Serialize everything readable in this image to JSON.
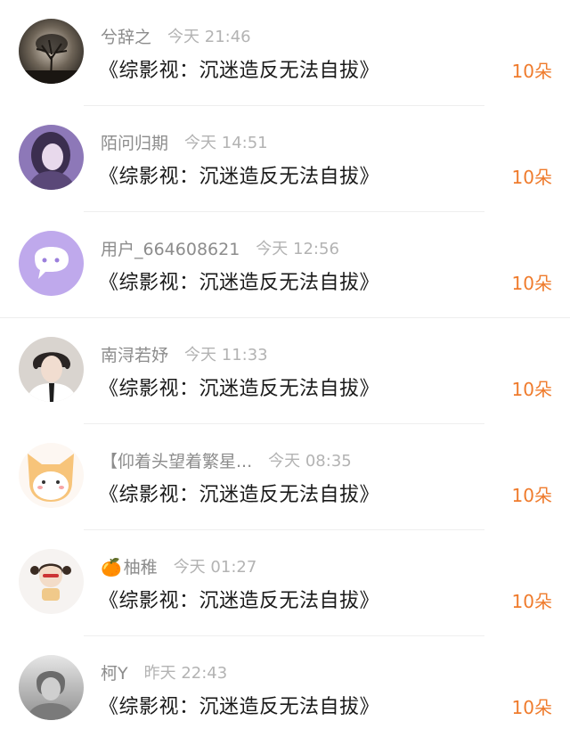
{
  "items": [
    {
      "username": "兮辞之",
      "time": "今天 21:46",
      "title": "《综影视：沉迷造反无法自拔》",
      "count": "10朵"
    },
    {
      "username": "陌问归期",
      "time": "今天 14:51",
      "title": "《综影视：沉迷造反无法自拔》",
      "count": "10朵"
    },
    {
      "username": "用户_664608621",
      "time": "今天 12:56",
      "title": "《综影视：沉迷造反无法自拔》",
      "count": "10朵"
    },
    {
      "username": "南浔若妤",
      "time": "今天 11:33",
      "title": "《综影视：沉迷造反无法自拔》",
      "count": "10朵"
    },
    {
      "username": "【仰着头望着繁星...",
      "time": "今天 08:35",
      "title": "《综影视：沉迷造反无法自拔》",
      "count": "10朵"
    },
    {
      "username_emoji": "🍊",
      "username": "柚稚",
      "time": "今天 01:27",
      "title": "《综影视：沉迷造反无法自拔》",
      "count": "10朵"
    },
    {
      "username": "柯Y",
      "time": "昨天 22:43",
      "title": "《综影视：沉迷造反无法自拔》",
      "count": "10朵"
    }
  ],
  "colors": {
    "accent": "#ef7b2c",
    "username": "#8c8c8c",
    "time": "#b3b3b3",
    "title": "#1a1a1a"
  }
}
